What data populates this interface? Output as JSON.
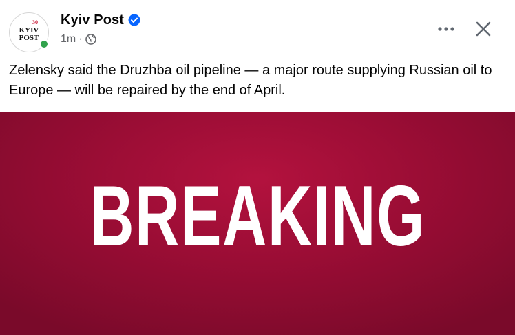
{
  "post": {
    "page_name": "Kyiv Post",
    "avatar_text": "KYIV POST",
    "avatar_badge": "30",
    "timestamp": "1m",
    "separator": "·",
    "audience_icon": "globe-icon",
    "verified_icon": "verified-badge-icon",
    "text": "Zelensky said the Druzhba oil pipeline — a major route supplying Russian oil to Europe — will be repaired by the end of April.",
    "image_text": "BREAKING",
    "image_bg_color": "#a50f38",
    "verified_color": "#0866ff",
    "online_color": "#31a24c"
  }
}
